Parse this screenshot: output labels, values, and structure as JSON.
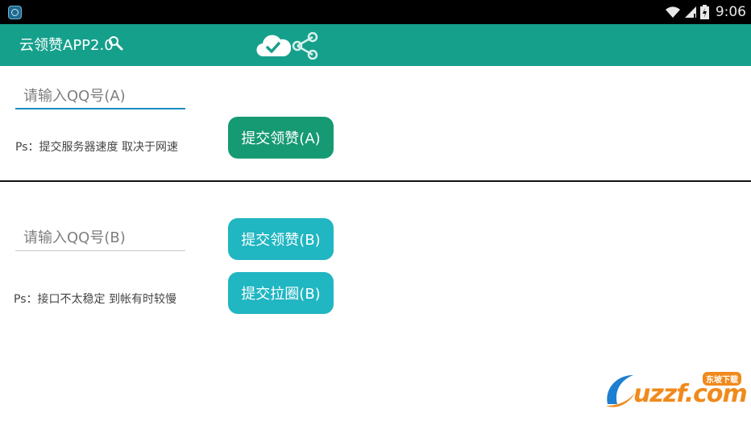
{
  "status_bar": {
    "time": "9:06"
  },
  "app_bar": {
    "title": "云领赞APP2.0"
  },
  "section_a": {
    "qq_input_placeholder": "请输入QQ号(A)",
    "submit_like_label": "提交领赞(A)",
    "note": "Ps：提交服务器速度 取决于网速"
  },
  "section_b": {
    "qq_input_placeholder": "请输入QQ号(B)",
    "submit_like_label": "提交领赞(B)",
    "submit_circle_label": "提交拉圈(B)",
    "note": "Ps：接口不太稳定 到帐有时较慢"
  },
  "watermark": {
    "text": "uzzf.com",
    "badge": "东坡下载"
  },
  "colors": {
    "app_bar": "#15a08c",
    "button_a": "#169a73",
    "button_b": "#20b6c2",
    "input_focus": "#1a8fbf"
  }
}
